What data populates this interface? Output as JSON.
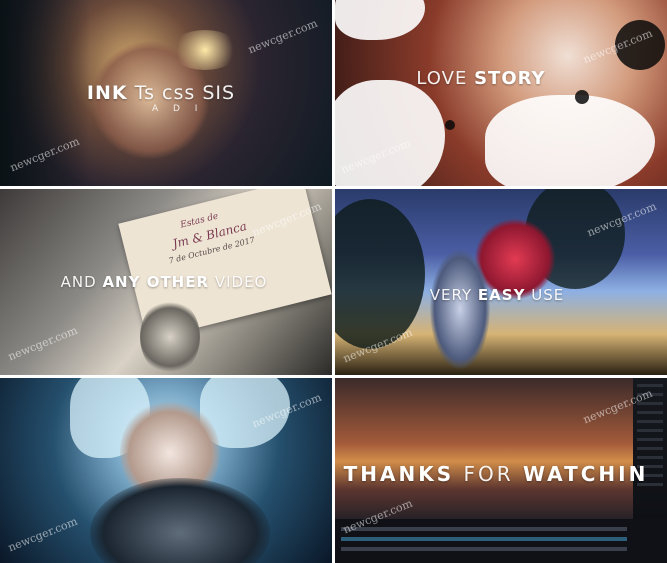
{
  "tiles": [
    {
      "caption_bold": "INK",
      "caption_light": "Ts css SIS",
      "subline": "A D I",
      "watermark": "newcger.com"
    },
    {
      "caption_light": "LOVE",
      "caption_bold": "STORY",
      "watermark": "newcger.com"
    },
    {
      "card_line1": "Estas de",
      "card_line2": "Jm & Blanca",
      "card_line3": "7 de Octubre de 2017",
      "caption_light_1": "AND",
      "caption_bold": "ANY OTHER",
      "caption_light_2": "VIDEO",
      "watermark": "newcger.com"
    },
    {
      "caption_light": "VERY",
      "caption_bold": "EASY",
      "caption_light_2": "USE",
      "watermark": "newcger.com"
    },
    {
      "watermark": "newcger.com"
    },
    {
      "caption_bold_1": "THANKS",
      "caption_light": "FOR",
      "caption_bold_2": "WATCHIN",
      "watermark": "newcger.com"
    }
  ],
  "colors": {
    "caption": "#ffffff",
    "gutter": "#ffffff"
  }
}
